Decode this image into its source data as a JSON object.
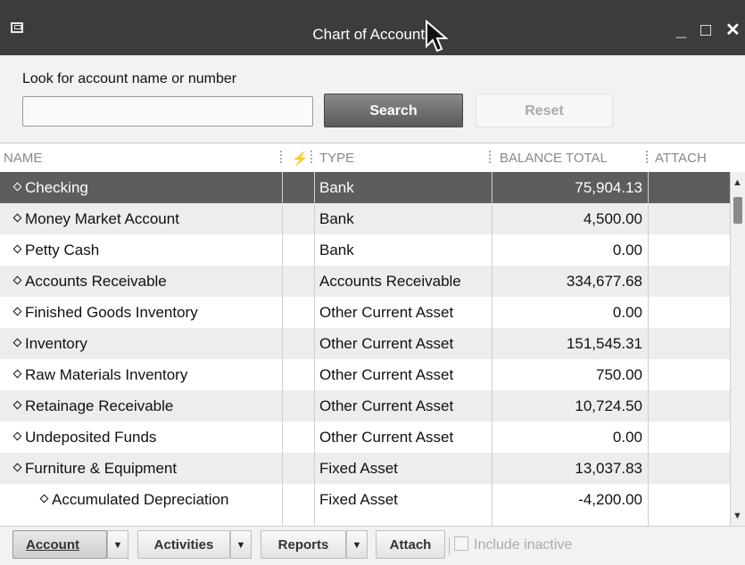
{
  "window": {
    "title": "Chart of Accounts",
    "controls": {
      "minimize": "_",
      "maximize": "□",
      "close": "✕"
    }
  },
  "search": {
    "label": "Look for account name or number",
    "input_value": "",
    "search_button": "Search",
    "reset_button": "Reset"
  },
  "columns": {
    "name": "NAME",
    "online": "⚡",
    "type": "TYPE",
    "balance": "BALANCE TOTAL",
    "attach": "ATTACH"
  },
  "accounts": [
    {
      "name": "Checking",
      "type": "Bank",
      "balance": "75,904.13",
      "selected": true,
      "sub": false
    },
    {
      "name": "Money Market Account",
      "type": "Bank",
      "balance": "4,500.00",
      "selected": false,
      "sub": false
    },
    {
      "name": "Petty Cash",
      "type": "Bank",
      "balance": "0.00",
      "selected": false,
      "sub": false
    },
    {
      "name": "Accounts Receivable",
      "type": "Accounts Receivable",
      "balance": "334,677.68",
      "selected": false,
      "sub": false
    },
    {
      "name": "Finished Goods Inventory",
      "type": "Other Current Asset",
      "balance": "0.00",
      "selected": false,
      "sub": false
    },
    {
      "name": "Inventory",
      "type": "Other Current Asset",
      "balance": "151,545.31",
      "selected": false,
      "sub": false
    },
    {
      "name": "Raw Materials Inventory",
      "type": "Other Current Asset",
      "balance": "750.00",
      "selected": false,
      "sub": false
    },
    {
      "name": "Retainage Receivable",
      "type": "Other Current Asset",
      "balance": "10,724.50",
      "selected": false,
      "sub": false
    },
    {
      "name": "Undeposited Funds",
      "type": "Other Current Asset",
      "balance": "0.00",
      "selected": false,
      "sub": false
    },
    {
      "name": "Furniture & Equipment",
      "type": "Fixed Asset",
      "balance": "13,037.83",
      "selected": false,
      "sub": false
    },
    {
      "name": "Accumulated Depreciation",
      "type": "Fixed Asset",
      "balance": "-4,200.00",
      "selected": false,
      "sub": true
    }
  ],
  "toolbar": {
    "account": "Account",
    "activities": "Activities",
    "reports": "Reports",
    "attach": "Attach",
    "include_inactive": "Include inactive",
    "include_inactive_checked": false
  },
  "colors": {
    "titlebar": "#3c3c3c",
    "selected_row": "#5d5d5d",
    "alt_row": "#ededed",
    "search_button": "#6e6e6e"
  },
  "icons": {
    "system_menu": "window-menu-icon",
    "cursor": "mouse-pointer-icon",
    "online_column": "lightning-icon",
    "row_marker": "diamond-bullet-icon"
  }
}
